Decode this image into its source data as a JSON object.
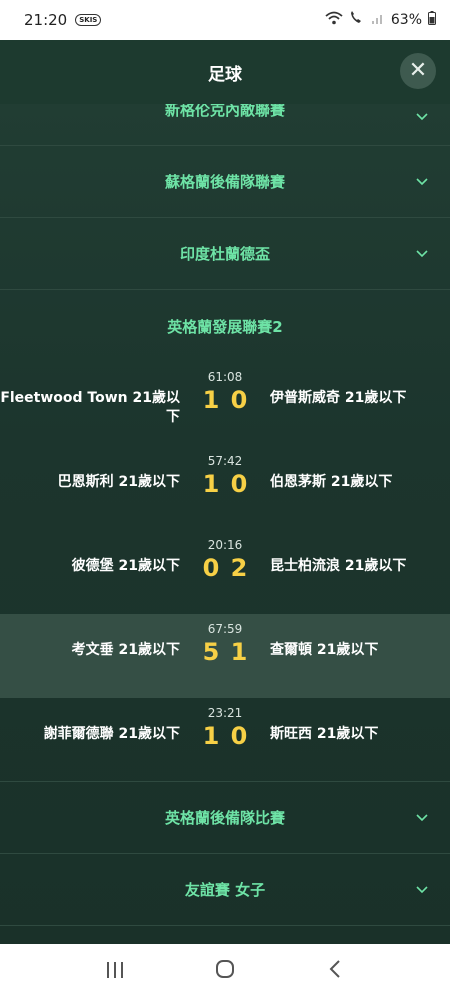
{
  "status": {
    "time": "21:20",
    "skis": "SKIS",
    "battery": "63%"
  },
  "header": {
    "title": "足球",
    "close_symbol": "✕"
  },
  "leagues_top": [
    {
      "name": "新格伦克內敵聯賽"
    },
    {
      "name": "蘇格蘭後備隊聯賽"
    },
    {
      "name": "印度杜蘭德盃"
    }
  ],
  "expanded_league": {
    "name": "英格蘭發展聯賽2",
    "matches": [
      {
        "time": "61:08",
        "home": "Fleetwood Town 21歲以下",
        "away": "伊普斯威奇 21歲以下",
        "home_score": "1",
        "away_score": "0"
      },
      {
        "time": "57:42",
        "home": "巴恩斯利 21歲以下",
        "away": "伯恩茅斯 21歲以下",
        "home_score": "1",
        "away_score": "0"
      },
      {
        "time": "20:16",
        "home": "彼德堡 21歲以下",
        "away": "昆士柏流浪 21歲以下",
        "home_score": "0",
        "away_score": "2"
      },
      {
        "time": "67:59",
        "home": "考文垂 21歲以下",
        "away": "查爾頓 21歲以下",
        "home_score": "5",
        "away_score": "1"
      },
      {
        "time": "23:21",
        "home": "謝菲爾德聯 21歲以下",
        "away": "斯旺西 21歲以下",
        "home_score": "1",
        "away_score": "0"
      }
    ]
  },
  "leagues_bottom": [
    {
      "name": "英格蘭後備隊比賽"
    },
    {
      "name": "友誼賽 女子"
    }
  ],
  "icons": {
    "chevron": "chevron-down-icon",
    "close": "close-icon",
    "nav_recent": "recent-apps-icon",
    "nav_home": "home-icon",
    "nav_back": "back-icon"
  },
  "colors": {
    "accent_green": "#6ee3a6",
    "score_yellow": "#f7d046",
    "background": "#1f3a30",
    "highlight_row": "#354f45"
  }
}
